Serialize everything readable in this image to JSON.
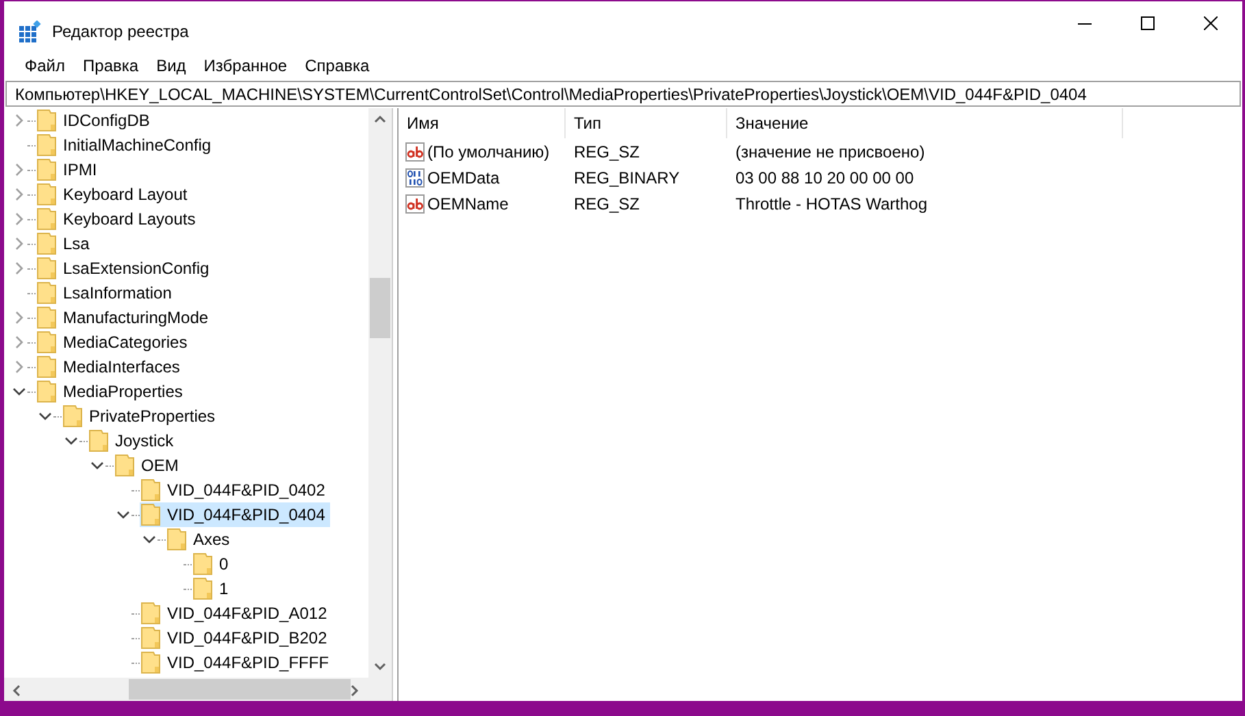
{
  "window": {
    "title": "Редактор реестра"
  },
  "menu": [
    "Файл",
    "Правка",
    "Вид",
    "Избранное",
    "Справка"
  ],
  "address": "Компьютер\\HKEY_LOCAL_MACHINE\\SYSTEM\\CurrentControlSet\\Control\\MediaProperties\\PrivateProperties\\Joystick\\OEM\\VID_044F&PID_0404",
  "tree": [
    {
      "label": "IDConfigDB",
      "expanded": false,
      "selected": false
    },
    {
      "label": "InitialMachineConfig",
      "selected": false
    },
    {
      "label": "IPMI",
      "expanded": false,
      "selected": false
    },
    {
      "label": "Keyboard Layout",
      "expanded": false,
      "selected": false
    },
    {
      "label": "Keyboard Layouts",
      "expanded": false,
      "selected": false
    },
    {
      "label": "Lsa",
      "expanded": false,
      "selected": false
    },
    {
      "label": "LsaExtensionConfig",
      "expanded": false,
      "selected": false
    },
    {
      "label": "LsaInformation",
      "selected": false
    },
    {
      "label": "ManufacturingMode",
      "expanded": false,
      "selected": false
    },
    {
      "label": "MediaCategories",
      "expanded": false,
      "selected": false
    },
    {
      "label": "MediaInterfaces",
      "expanded": false,
      "selected": false
    },
    {
      "label": "MediaProperties",
      "expanded": true,
      "selected": false,
      "children": [
        {
          "label": "PrivateProperties",
          "expanded": true,
          "selected": false,
          "children": [
            {
              "label": "Joystick",
              "expanded": true,
              "selected": false,
              "children": [
                {
                  "label": "OEM",
                  "expanded": true,
                  "selected": false,
                  "children": [
                    {
                      "label": "VID_044F&PID_0402",
                      "selected": false
                    },
                    {
                      "label": "VID_044F&PID_0404",
                      "expanded": true,
                      "selected": true,
                      "children": [
                        {
                          "label": "Axes",
                          "expanded": true,
                          "selected": false,
                          "children": [
                            {
                              "label": "0",
                              "selected": false
                            },
                            {
                              "label": "1",
                              "selected": false
                            }
                          ]
                        }
                      ]
                    },
                    {
                      "label": "VID_044F&PID_A012",
                      "selected": false
                    },
                    {
                      "label": "VID_044F&PID_B202",
                      "selected": false
                    },
                    {
                      "label": "VID_044F&PID_FFFF",
                      "selected": false
                    }
                  ]
                }
              ]
            }
          ]
        }
      ]
    }
  ],
  "values": {
    "columns": [
      "Имя",
      "Тип",
      "Значение"
    ],
    "rows": [
      {
        "kind": "string",
        "name": "(По умолчанию)",
        "type": "REG_SZ",
        "data": "(значение не присвоено)"
      },
      {
        "kind": "binary",
        "name": "OEMData",
        "type": "REG_BINARY",
        "data": "03 00 88 10 20 00 00 00"
      },
      {
        "kind": "string",
        "name": "OEMName",
        "type": "REG_SZ",
        "data": "Throttle - HOTAS Warthog"
      }
    ]
  }
}
